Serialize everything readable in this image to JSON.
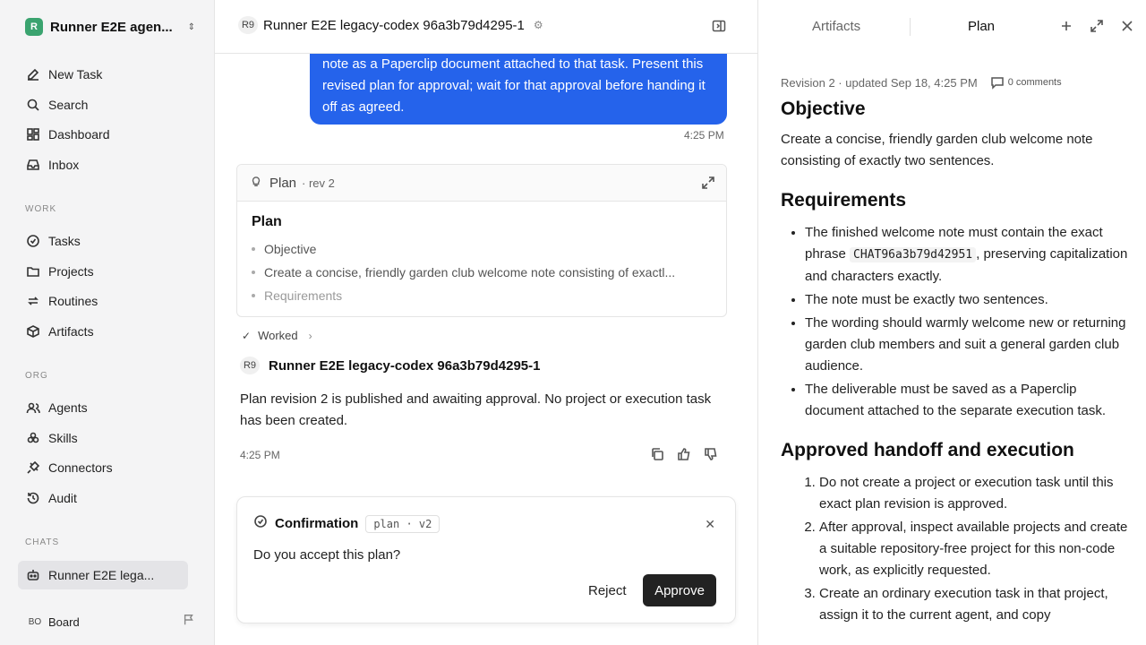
{
  "sidebar": {
    "workspace": {
      "logo": "R",
      "name": "Runner E2E agen..."
    },
    "items": [
      {
        "label": "New Task",
        "icon": "edit-icon"
      },
      {
        "label": "Search",
        "icon": "search-icon"
      },
      {
        "label": "Dashboard",
        "icon": "dashboard-icon"
      },
      {
        "label": "Inbox",
        "icon": "inbox-icon"
      }
    ],
    "work_label": "WORK",
    "work_items": [
      {
        "label": "Tasks",
        "icon": "check-circle-icon"
      },
      {
        "label": "Projects",
        "icon": "folder-icon"
      },
      {
        "label": "Routines",
        "icon": "repeat-icon"
      },
      {
        "label": "Artifacts",
        "icon": "box-icon"
      }
    ],
    "org_label": "ORG",
    "org_items": [
      {
        "label": "Agents",
        "icon": "users-icon"
      },
      {
        "label": "Skills",
        "icon": "skills-icon"
      },
      {
        "label": "Connectors",
        "icon": "plug-icon"
      },
      {
        "label": "Audit",
        "icon": "history-icon"
      }
    ],
    "chats_label": "CHATS",
    "chats": [
      {
        "label": "Runner E2E lega...",
        "icon": "bot-icon"
      }
    ],
    "board": {
      "initials": "BO",
      "name": "Board"
    }
  },
  "chat": {
    "agent_badge": "R9",
    "title": "Runner E2E legacy-codex 96a3b79d4295-1",
    "user_message": "note as a Paperclip document attached to that task. Present this revised plan for approval; wait for that approval before handing it off as agreed.",
    "user_time": "4:25 PM",
    "plan_card": {
      "label": "Plan",
      "rev": "· rev 2",
      "heading": "Plan",
      "items": [
        "Objective",
        "Create a concise, friendly garden club welcome note consisting of exactl...",
        "Requirements"
      ]
    },
    "worked_label": "Worked",
    "agent_name": "Runner E2E legacy-codex 96a3b79d4295-1",
    "agent_message": "Plan revision 2 is published and awaiting approval. No project or execution task has been created.",
    "agent_time": "4:25 PM",
    "confirmation": {
      "title": "Confirmation",
      "tag": "plan · v2",
      "question": "Do you accept this plan?",
      "reject_label": "Reject",
      "approve_label": "Approve"
    }
  },
  "panel": {
    "tabs": [
      "Artifacts",
      "Plan"
    ],
    "active_tab": "Plan",
    "meta": "Revision 2 · updated Sep 18, 4:25 PM",
    "comments": "0 comments",
    "objective_heading": "Objective",
    "objective_text": "Create a concise, friendly garden club welcome note consisting of exactly two sentences.",
    "requirements_heading": "Requirements",
    "req1_pre": "The finished welcome note must contain the exact phrase ",
    "req1_code": "CHAT96a3b79d42951",
    "req1_post": ", preserving capitalization and characters exactly.",
    "requirements": [
      "The note must be exactly two sentences.",
      "The wording should warmly welcome new or returning garden club members and suit a general garden club audience.",
      "The deliverable must be saved as a Paperclip document attached to the separate execution task."
    ],
    "handoff_heading": "Approved handoff and execution",
    "handoff_steps": [
      "Do not create a project or execution task until this exact plan revision is approved.",
      "After approval, inspect available projects and create a suitable repository-free project for this non-code work, as explicitly requested.",
      "Create an ordinary execution task in that project, assign it to the current agent, and copy"
    ]
  }
}
